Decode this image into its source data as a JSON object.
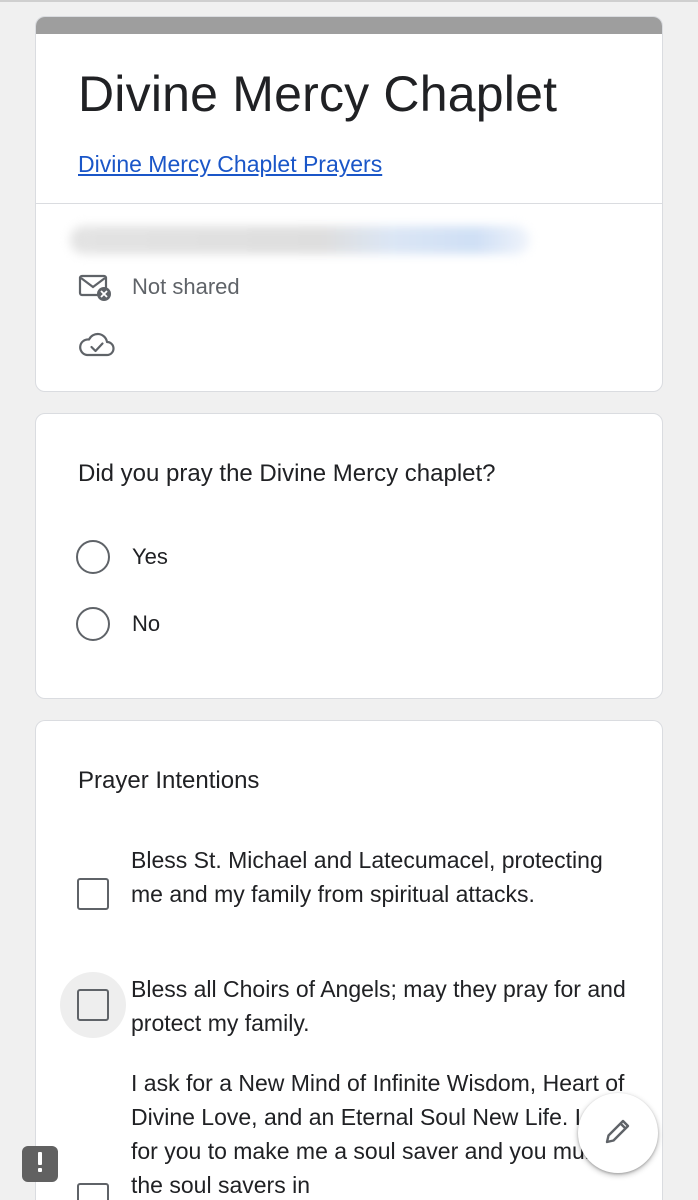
{
  "form": {
    "title": "Divine Mercy Chaplet",
    "link_text": "Divine Mercy Chaplet Prayers",
    "email_status": "Not shared",
    "icons": {
      "email": "email-not-shared-icon",
      "cloud": "cloud-saved-icon"
    },
    "accent_color": "#9e9e9e",
    "link_color": "#1a56c8"
  },
  "question1": {
    "title": "Did you pray the Divine Mercy chaplet?",
    "options": [
      "Yes",
      "No"
    ]
  },
  "question2": {
    "title": "Prayer Intentions",
    "options": [
      "Bless St. Michael and Latecumacel, protecting me and my family from spiritual attacks.",
      "Bless all Choirs of Angels; may they pray for and protect my family.",
      "I ask for a New Mind of Infinite Wisdom, Heart of Divine Love, and an Eternal Soul New Life. I ask for you to make me a soul saver and you multiply the soul savers in"
    ]
  },
  "fab_icon": "pencil-edit-icon",
  "report_icon": "report-problem-icon"
}
